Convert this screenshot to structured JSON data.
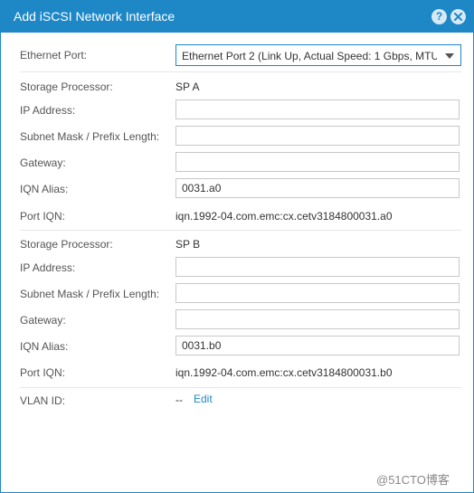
{
  "dialog": {
    "title": "Add iSCSI Network Interface",
    "help_label": "?",
    "close_icon": "close-icon",
    "accent": "#1e88c7"
  },
  "ethernet_port": {
    "label": "Ethernet Port:",
    "selected": "Ethernet Port 2 (Link Up, Actual Speed: 1 Gbps, MTU"
  },
  "sp_a": {
    "storage_processor_label": "Storage Processor:",
    "storage_processor_value": "SP A",
    "ip_label": "IP Address:",
    "ip_value": "",
    "subnet_label": "Subnet Mask / Prefix Length:",
    "subnet_value": "",
    "gateway_label": "Gateway:",
    "gateway_value": "",
    "iqn_alias_label": "IQN Alias:",
    "iqn_alias_value": "0031.a0",
    "port_iqn_label": "Port IQN:",
    "port_iqn_value": "iqn.1992-04.com.emc:cx.cetv3184800031.a0"
  },
  "sp_b": {
    "storage_processor_label": "Storage Processor:",
    "storage_processor_value": "SP B",
    "ip_label": "IP Address:",
    "ip_value": "",
    "subnet_label": "Subnet Mask / Prefix Length:",
    "subnet_value": "",
    "gateway_label": "Gateway:",
    "gateway_value": "",
    "iqn_alias_label": "IQN Alias:",
    "iqn_alias_value": "0031.b0",
    "port_iqn_label": "Port IQN:",
    "port_iqn_value": "iqn.1992-04.com.emc:cx.cetv3184800031.b0"
  },
  "vlan": {
    "label": "VLAN ID:",
    "value": "--",
    "edit_label": "Edit"
  },
  "watermark": "@51CTO博客"
}
